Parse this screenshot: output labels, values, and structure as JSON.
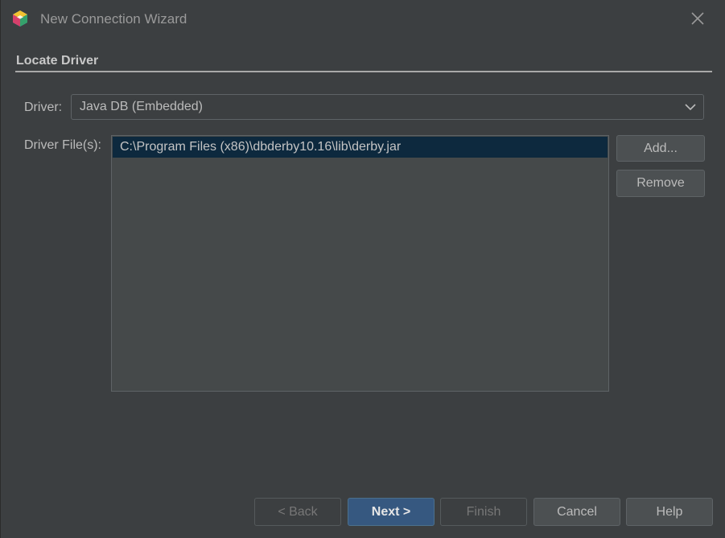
{
  "window": {
    "title": "New Connection Wizard",
    "icon": "netbeans-cube-icon",
    "close_icon": "close-icon"
  },
  "section": {
    "title": "Locate Driver"
  },
  "driver": {
    "label": "Driver:",
    "selected": "Java DB (Embedded)",
    "dropdown_icon": "chevron-down-icon"
  },
  "driver_files": {
    "label": "Driver File(s):",
    "items": [
      "C:\\Program Files (x86)\\dbderby10.16\\lib\\derby.jar"
    ],
    "selected_index": 0
  },
  "side_buttons": {
    "add_label": "Add...",
    "remove_label": "Remove"
  },
  "footer": {
    "back_label": "< Back",
    "next_label": "Next >",
    "finish_label": "Finish",
    "cancel_label": "Cancel",
    "help_label": "Help"
  },
  "colors": {
    "background": "#3c3f41",
    "list_background": "#45494a",
    "selection": "#0d293e",
    "primary_button": "#365880",
    "button": "#4c5052",
    "text": "#bbbbbb"
  }
}
